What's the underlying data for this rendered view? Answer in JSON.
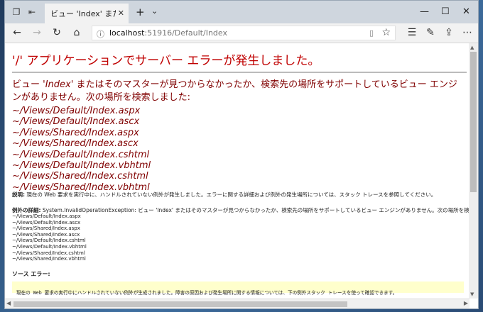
{
  "browser": {
    "tab_title": "ビュー 'Index' またはそのマス",
    "tab_close_icon": "close-icon",
    "new_tab_icon": "plus-icon",
    "tab_menu_icon": "chevron-down-icon",
    "url_host": "localhost",
    "url_path": ":51916/Default/Index",
    "window_controls": [
      "minimize",
      "maximize",
      "close"
    ]
  },
  "page": {
    "heading": "'/' アプリケーションでサーバー エラーが発生しました。",
    "message_prefix": "ビュー ",
    "message_view": "'Index'",
    "message_rest": " またはそのマスターが見つからなかったか、検索先の場所をサポートしているビュー エンジンがありません。次の場所を検索しました:",
    "searched_paths": [
      "~/Views/Default/Index.aspx",
      "~/Views/Default/Index.ascx",
      "~/Views/Shared/Index.aspx",
      "~/Views/Shared/Index.ascx",
      "~/Views/Default/Index.cshtml",
      "~/Views/Default/Index.vbhtml",
      "~/Views/Shared/Index.cshtml",
      "~/Views/Shared/Index.vbhtml"
    ],
    "description_label": "説明:",
    "description_text": " 現在の Web 要求を実行中に、ハンドルされていない例外が発生しました。エラーに関する詳細および例外の発生場所については、スタック トレースを参照してください。",
    "exception_label": "例外の詳細:",
    "exception_text": " System.InvalidOperationException: ビュー 'Index' またはそのマスターが見つからなかったか、検索先の場所をサポートしているビュー エンジンがありません。次の場所を検索しました:",
    "source_error_label": "ソース エラー:",
    "source_error_text": "現在の Web 要求の実行中にハンドルされていない例外が生成されました。障害の原因および発生場所に関する情報については、下の例外スタック トレースを使って確認できます。"
  }
}
